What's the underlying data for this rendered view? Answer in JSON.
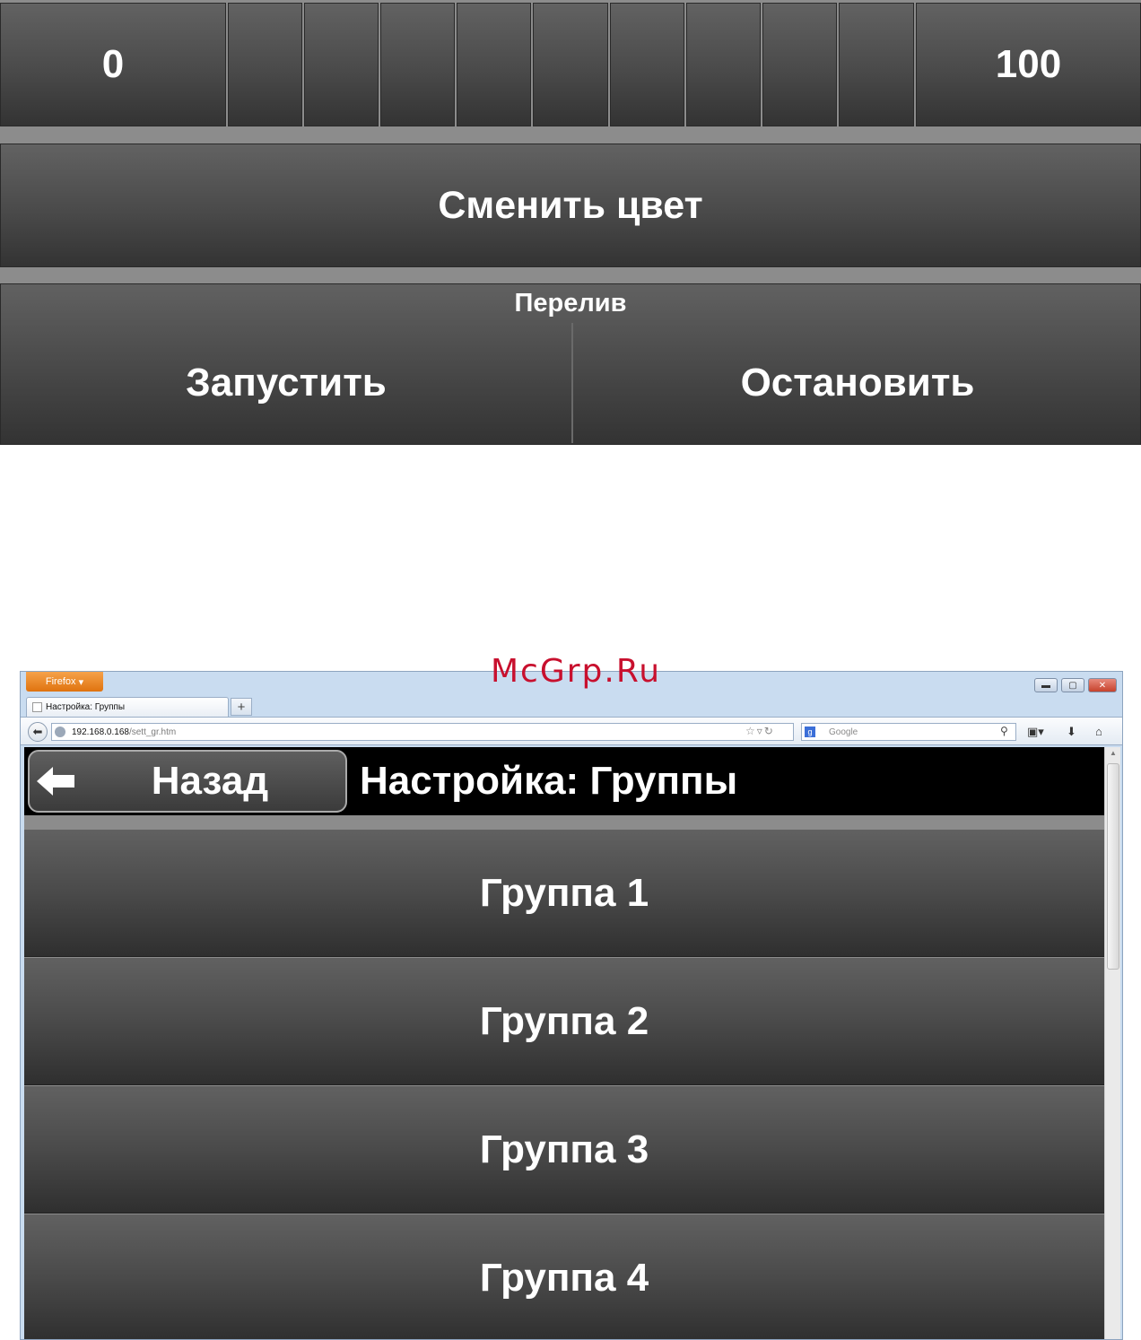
{
  "top_panel": {
    "dimmer": {
      "min_label": "0",
      "max_label": "100",
      "segments": 9
    },
    "change_color_label": "Сменить цвет",
    "overflow": {
      "title": "Перелив",
      "start_label": "Запустить",
      "stop_label": "Остановить"
    }
  },
  "watermark": "McGrp.Ru",
  "browser": {
    "menu_label": "Firefox",
    "tab_title": "Настройка: Группы",
    "new_tab_label": "+",
    "url_host": "192.168.0.168",
    "url_path": "/sett_gr.htm",
    "search_placeholder": "Google"
  },
  "page": {
    "back_label": "Назад",
    "title": "Настройка: Группы",
    "groups": [
      "Группа 1",
      "Группа 2",
      "Группа 3",
      "Группа 4"
    ]
  },
  "colors": {
    "button_top": "#626262",
    "button_bottom": "#333333",
    "panel_gap": "#8c8c8c",
    "header_bg": "#000000",
    "watermark": "#c8102e",
    "firefox_orange": "#e0730f"
  }
}
